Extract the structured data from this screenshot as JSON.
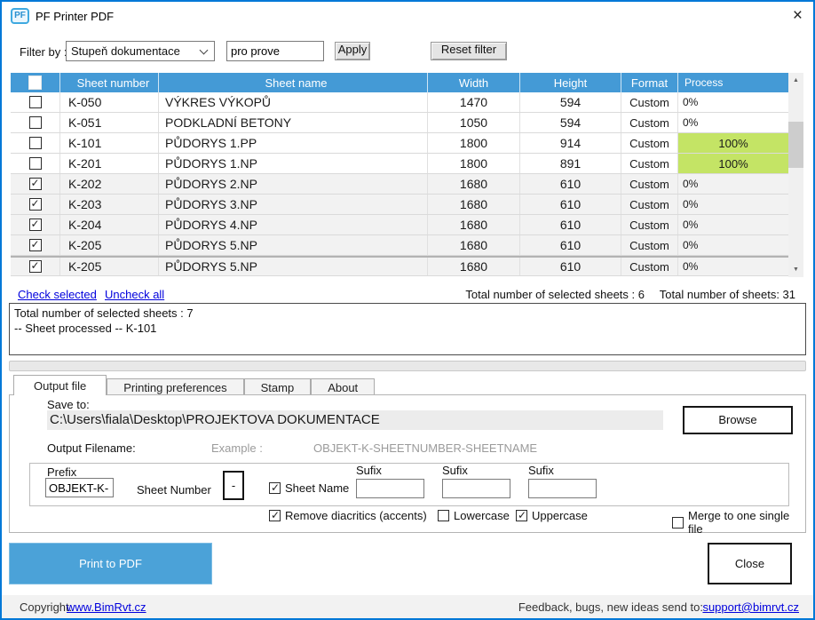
{
  "window": {
    "title": "PF Printer PDF",
    "icon": "PF",
    "close": "×"
  },
  "filter": {
    "label": "Filter by :",
    "dropdown_value": "Stupeň dokumentace",
    "search_value": "pro prove",
    "apply": "Apply",
    "reset": "Reset filter"
  },
  "table": {
    "columns": {
      "number": "Sheet number",
      "name": "Sheet name",
      "width": "Width",
      "height": "Height",
      "format": "Format",
      "process": "Process"
    },
    "rows": [
      {
        "checked": false,
        "number": "K-050",
        "name": "VÝKRES VÝKOPŮ",
        "width": "1470",
        "height": "594",
        "format": "Custom",
        "process": "0%",
        "progress": 0
      },
      {
        "checked": false,
        "number": "K-051",
        "name": "PODKLADNÍ BETONY",
        "width": "1050",
        "height": "594",
        "format": "Custom",
        "process": "0%",
        "progress": 0
      },
      {
        "checked": false,
        "number": "K-101",
        "name": "PŮDORYS 1.PP",
        "width": "1800",
        "height": "914",
        "format": "Custom",
        "process": "100%",
        "progress": 100
      },
      {
        "checked": false,
        "number": "K-201",
        "name": "PŮDORYS 1.NP",
        "width": "1800",
        "height": "891",
        "format": "Custom",
        "process": "100%",
        "progress": 100
      },
      {
        "checked": true,
        "number": "K-202",
        "name": "PŮDORYS 2.NP",
        "width": "1680",
        "height": "610",
        "format": "Custom",
        "process": "0%",
        "progress": 0
      },
      {
        "checked": true,
        "number": "K-203",
        "name": "PŮDORYS 3.NP",
        "width": "1680",
        "height": "610",
        "format": "Custom",
        "process": "0%",
        "progress": 0
      },
      {
        "checked": true,
        "number": "K-204",
        "name": "PŮDORYS 4.NP",
        "width": "1680",
        "height": "610",
        "format": "Custom",
        "process": "0%",
        "progress": 0
      },
      {
        "checked": true,
        "number": "K-205",
        "name": "PŮDORYS 5.NP",
        "width": "1680",
        "height": "610",
        "format": "Custom",
        "process": "0%",
        "progress": 0
      },
      {
        "checked": true,
        "number": "K-205",
        "name": "PŮDORYS 5.NP",
        "width": "1680",
        "height": "610",
        "format": "Custom",
        "process": "0%",
        "progress": 0,
        "partial": true
      }
    ]
  },
  "selection": {
    "check_selected": "Check selected",
    "uncheck_all": "Uncheck all",
    "selected_total": "Total number of selected sheets : 6",
    "sheets_total": "Total number of sheets:  31"
  },
  "log": {
    "line1": "Total number of selected sheets : 7",
    "line2": "-- Sheet processed -- K-101"
  },
  "tabs": {
    "output_file": "Output file",
    "printing_preferences": "Printing preferences",
    "stamp": "Stamp",
    "about": "About"
  },
  "output": {
    "save_to_label": "Save to:",
    "path": "C:\\Users\\fiala\\Desktop\\PROJEKTOVA DOKUMENTACE",
    "browse": "Browse",
    "filename_label": "Output Filename:",
    "example_label": "Example :",
    "example_value": "OBJEKT-K-SHEETNUMBER-SHEETNAME",
    "prefix_label": "Prefix",
    "prefix_value": "OBJEKT-K-",
    "sheet_number_label": "Sheet Number",
    "separator": "-",
    "sheet_name": {
      "label": "Sheet Name",
      "checked": true
    },
    "sufix_label": "Sufix",
    "sufix1": "",
    "sufix2": "",
    "sufix3": "",
    "options": {
      "diacritics": {
        "label": "Remove diacritics (accents)",
        "checked": true
      },
      "lowercase": {
        "label": "Lowercase",
        "checked": false
      },
      "uppercase": {
        "label": "Uppercase",
        "checked": true
      },
      "merge": {
        "label": "Merge to one single file",
        "checked": false
      }
    }
  },
  "actions": {
    "print": "Print to PDF",
    "close": "Close"
  },
  "footer": {
    "copyright_label": "Copyright:",
    "copyright_link": "www.BimRvt.cz",
    "feedback_label": "Feedback, bugs, new ideas send to:",
    "feedback_link": "support@bimrvt.cz"
  },
  "colors": {
    "accent_blue": "#449ad6",
    "button_blue": "#4ba2d8",
    "progress_green": "#c4e465",
    "link_blue": "#0000dd",
    "window_border": "#0078d7"
  }
}
